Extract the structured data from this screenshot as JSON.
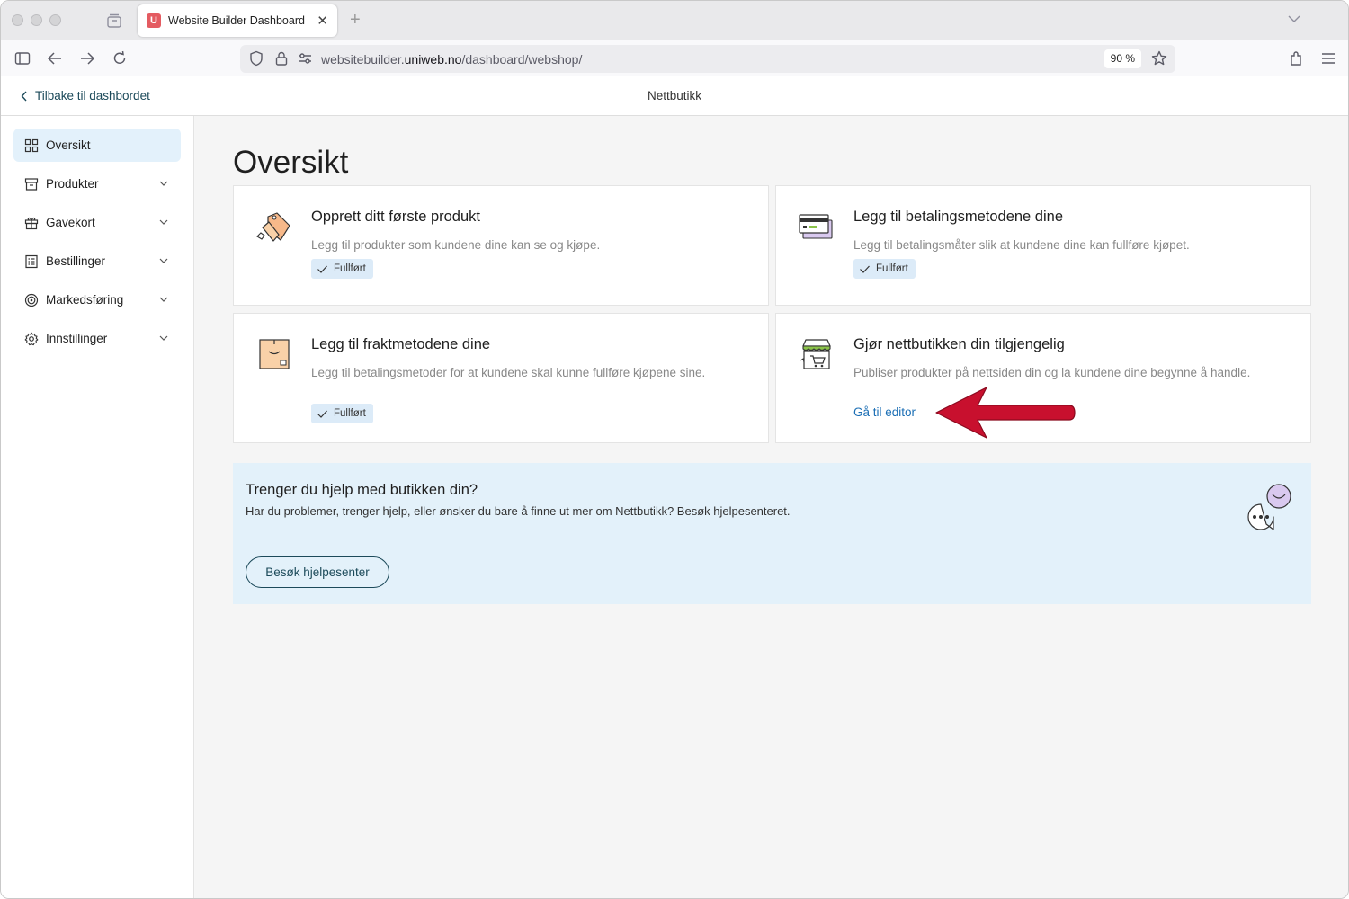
{
  "browser": {
    "tab_title": "Website Builder Dashboard",
    "tab_favicon_letter": "U",
    "url_prefix": "websitebuilder.",
    "url_domain": "uniweb.no",
    "url_path": "/dashboard/webshop/",
    "zoom": "90 %"
  },
  "header": {
    "back_label": "Tilbake til dashbordet",
    "title": "Nettbutikk"
  },
  "sidebar": {
    "items": [
      {
        "label": "Oversikt",
        "icon": "grid-icon",
        "active": true
      },
      {
        "label": "Produkter",
        "icon": "box-icon"
      },
      {
        "label": "Gavekort",
        "icon": "gift-icon"
      },
      {
        "label": "Bestillinger",
        "icon": "list-icon"
      },
      {
        "label": "Markedsføring",
        "icon": "target-icon"
      },
      {
        "label": "Innstillinger",
        "icon": "gear-icon"
      }
    ]
  },
  "main": {
    "title": "Oversikt",
    "cards": [
      {
        "title": "Opprett ditt første produkt",
        "description": "Legg til produkter som kundene dine kan se og kjøpe.",
        "status": "Fullført",
        "icon": "price-tag-icon"
      },
      {
        "title": "Legg til betalingsmetodene dine",
        "description": "Legg til betalingsmåter slik at kundene dine kan fullføre kjøpet.",
        "status": "Fullført",
        "icon": "credit-card-icon"
      },
      {
        "title": "Legg til fraktmetodene dine",
        "description": "Legg til betalingsmetoder for at kundene skal kunne fullføre kjøpene sine.",
        "status": "Fullført",
        "icon": "package-icon"
      },
      {
        "title": "Gjør nettbutikken din tilgjengelig",
        "description": "Publiser produkter på nettsiden din og la kundene dine begynne å handle.",
        "link": "Gå til editor",
        "icon": "storefront-icon"
      }
    ],
    "help": {
      "title": "Trenger du hjelp med butikken din?",
      "text": "Har du problemer, trenger hjelp, eller ønsker du bare å finne ut mer om Nettbutikk? Besøk hjelpesenteret.",
      "button": "Besøk hjelpesenter",
      "icon": "chat-bubbles-icon"
    }
  },
  "annotation": {
    "icon": "red-arrow-icon",
    "color": "#c8102e"
  }
}
